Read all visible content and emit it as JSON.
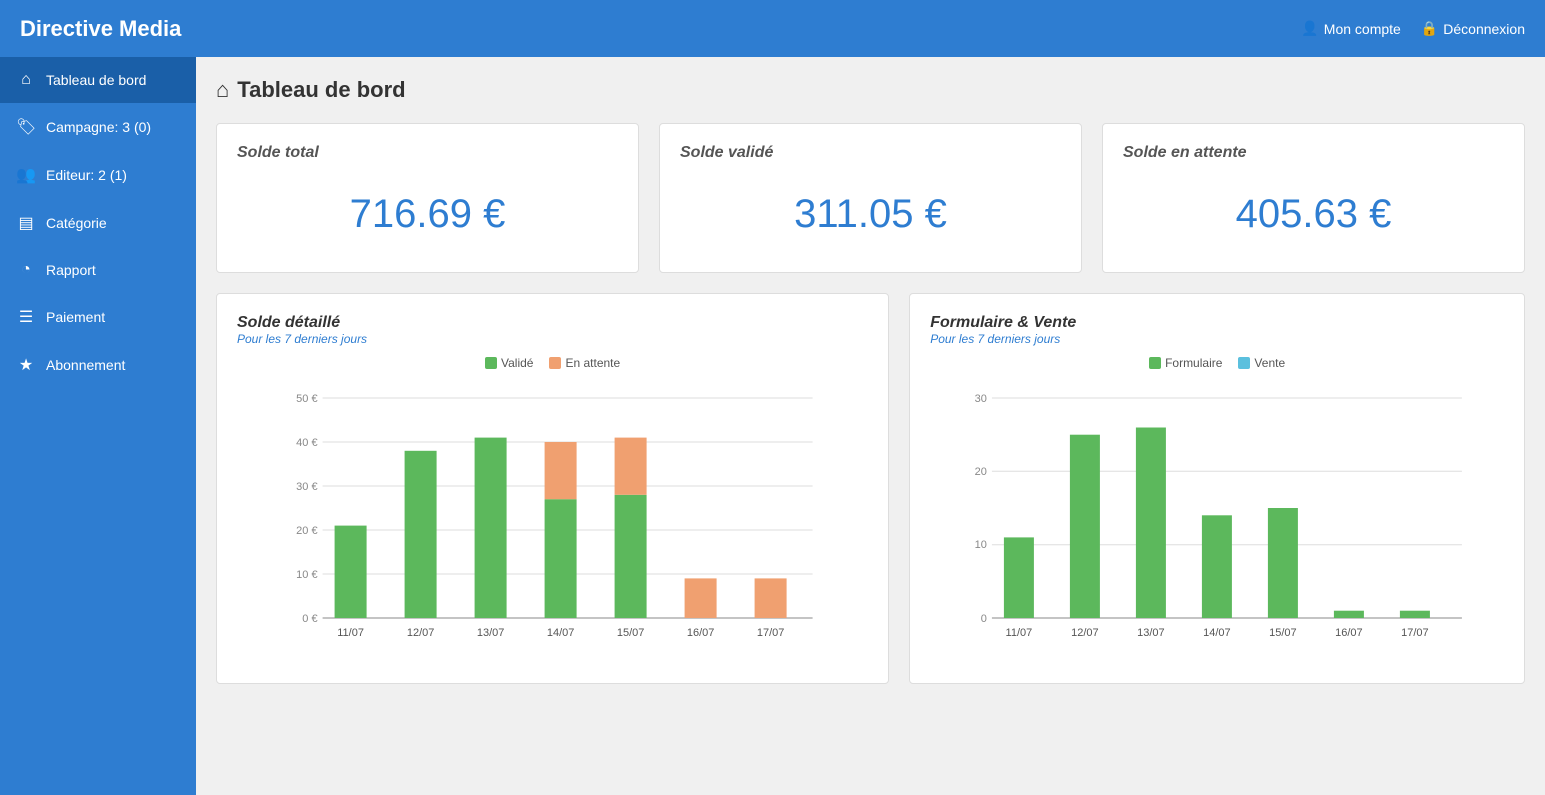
{
  "header": {
    "title": "Directive Media",
    "mon_compte": "Mon compte",
    "deconnexion": "Déconnexion"
  },
  "sidebar": {
    "items": [
      {
        "id": "tableau-de-bord",
        "label": "Tableau de bord",
        "icon": "🏠",
        "active": true
      },
      {
        "id": "campagne",
        "label": "Campagne: 3 (0)",
        "icon": "🏷️",
        "active": false
      },
      {
        "id": "editeur",
        "label": "Editeur: 2 (1)",
        "icon": "👥",
        "active": false
      },
      {
        "id": "categorie",
        "label": "Catégorie",
        "icon": "▤",
        "active": false
      },
      {
        "id": "rapport",
        "label": "Rapport",
        "icon": "◔",
        "active": false
      },
      {
        "id": "paiement",
        "label": "Paiement",
        "icon": "☰",
        "active": false
      },
      {
        "id": "abonnement",
        "label": "Abonnement",
        "icon": "★",
        "active": false
      }
    ]
  },
  "page": {
    "title": "Tableau de bord"
  },
  "stats": [
    {
      "id": "solde-total",
      "label": "Solde total",
      "value": "716.69 €"
    },
    {
      "id": "solde-valide",
      "label": "Solde validé",
      "value": "311.05 €"
    },
    {
      "id": "solde-attente",
      "label": "Solde en attente",
      "value": "405.63 €"
    }
  ],
  "chart_left": {
    "title": "Solde détaillé",
    "subtitle": "Pour les 7 derniers jours",
    "legend": [
      {
        "label": "Validé",
        "color": "#5cb85c"
      },
      {
        "label": "En attente",
        "color": "#f0a070"
      }
    ],
    "yMax": 50,
    "yLabels": [
      "50 €",
      "40 €",
      "30 €",
      "20 €",
      "10 €",
      "0 €"
    ],
    "bars": [
      {
        "date": "11/07",
        "valide": 21,
        "attente": 0
      },
      {
        "date": "12/07",
        "valide": 38,
        "attente": 0
      },
      {
        "date": "13/07",
        "valide": 41,
        "attente": 0
      },
      {
        "date": "14/07",
        "valide": 27,
        "attente": 13
      },
      {
        "date": "15/07",
        "valide": 28,
        "attente": 13
      },
      {
        "date": "16/07",
        "valide": 0,
        "attente": 9
      },
      {
        "date": "17/07",
        "valide": 0,
        "attente": 9
      }
    ]
  },
  "chart_right": {
    "title": "Formulaire & Vente",
    "subtitle": "Pour les 7 derniers jours",
    "legend": [
      {
        "label": "Formulaire",
        "color": "#5cb85c"
      },
      {
        "label": "Vente",
        "color": "#5bc0de"
      }
    ],
    "yMax": 30,
    "yLabels": [
      "30",
      "20",
      "10",
      "0"
    ],
    "bars": [
      {
        "date": "11/07",
        "formulaire": 11,
        "vente": 0
      },
      {
        "date": "12/07",
        "formulaire": 25,
        "vente": 0
      },
      {
        "date": "13/07",
        "formulaire": 26,
        "vente": 0
      },
      {
        "date": "14/07",
        "formulaire": 14,
        "vente": 0
      },
      {
        "date": "15/07",
        "formulaire": 15,
        "vente": 0
      },
      {
        "date": "16/07",
        "formulaire": 1,
        "vente": 0
      },
      {
        "date": "17/07",
        "formulaire": 1,
        "vente": 0
      }
    ]
  }
}
